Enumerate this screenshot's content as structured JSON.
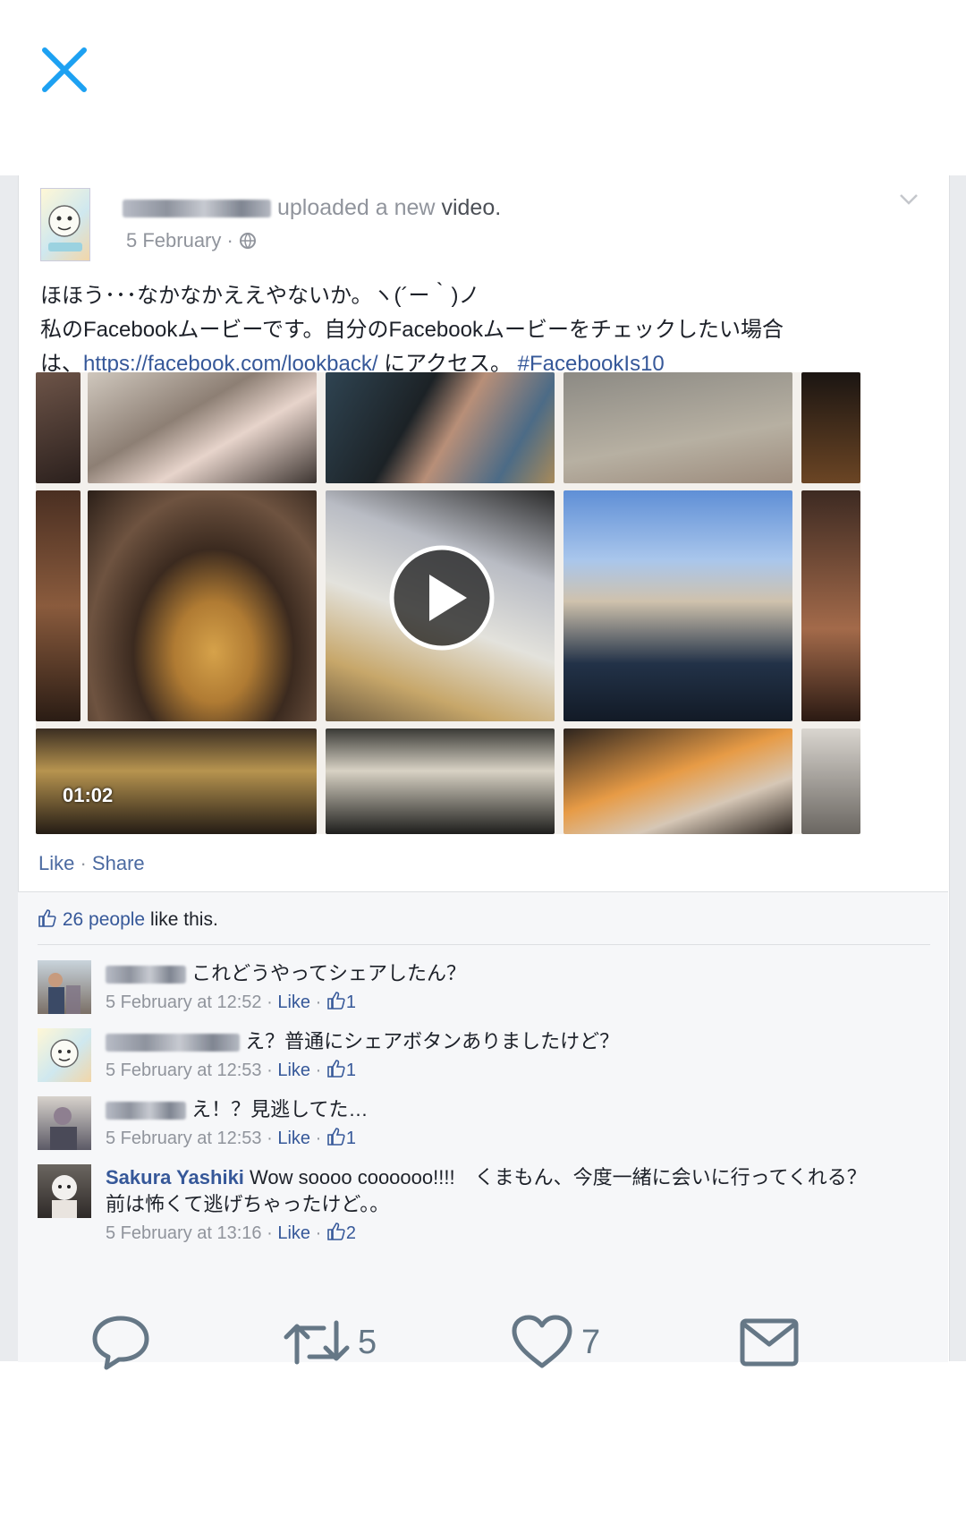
{
  "close": {
    "icon": "close-icon",
    "color": "#1da1f2"
  },
  "post": {
    "uploader_suffix": "uploaded a new",
    "uploader_video": "video.",
    "date": "5 February ·",
    "text_line1": "ほほう･･･なかなかええやないか。ヽ(´ー｀)ノ",
    "text_line2": "私のFacebookムービーです。自分のFacebookムービーをチェックしたい場合",
    "text_line3_pre": "は、",
    "link": "https://facebook.com/lookback/",
    "text_line3_mid": " にアクセス。 ",
    "hashtag": "#FacebookIs10",
    "video_duration": "01:02",
    "like": "Like",
    "share": "Share"
  },
  "likes": {
    "count": "26 people",
    "suffix": " like this."
  },
  "comments": [
    {
      "name": "",
      "text": "これどうやってシェアしたん？",
      "time": "5 February at 12:52 ·",
      "like": "Like",
      "likes": "1"
    },
    {
      "name": "",
      "text": "え？普通にシェアボタンありましたけど？",
      "time": "5 February at 12:53 ·",
      "like": "Like",
      "likes": "1"
    },
    {
      "name": "",
      "text": "え！？見逃してた…",
      "time": "5 February at 12:53 ·",
      "like": "Like",
      "likes": "1"
    },
    {
      "name": "Sakura Yashiki",
      "text": " Wow soooo coooooo!!!!　くまもん、今度一緒に会いに行ってくれる？前は怖くて逃げちゃったけど。。",
      "time": "5 February at 13:16 ·",
      "like": "Like",
      "likes": "2"
    }
  ],
  "tweet_actions": {
    "reply": {
      "icon": "reply-icon"
    },
    "retweet": {
      "icon": "retweet-icon",
      "count": "5"
    },
    "like": {
      "icon": "heart-icon",
      "count": "7"
    },
    "dm": {
      "icon": "envelope-icon"
    }
  }
}
